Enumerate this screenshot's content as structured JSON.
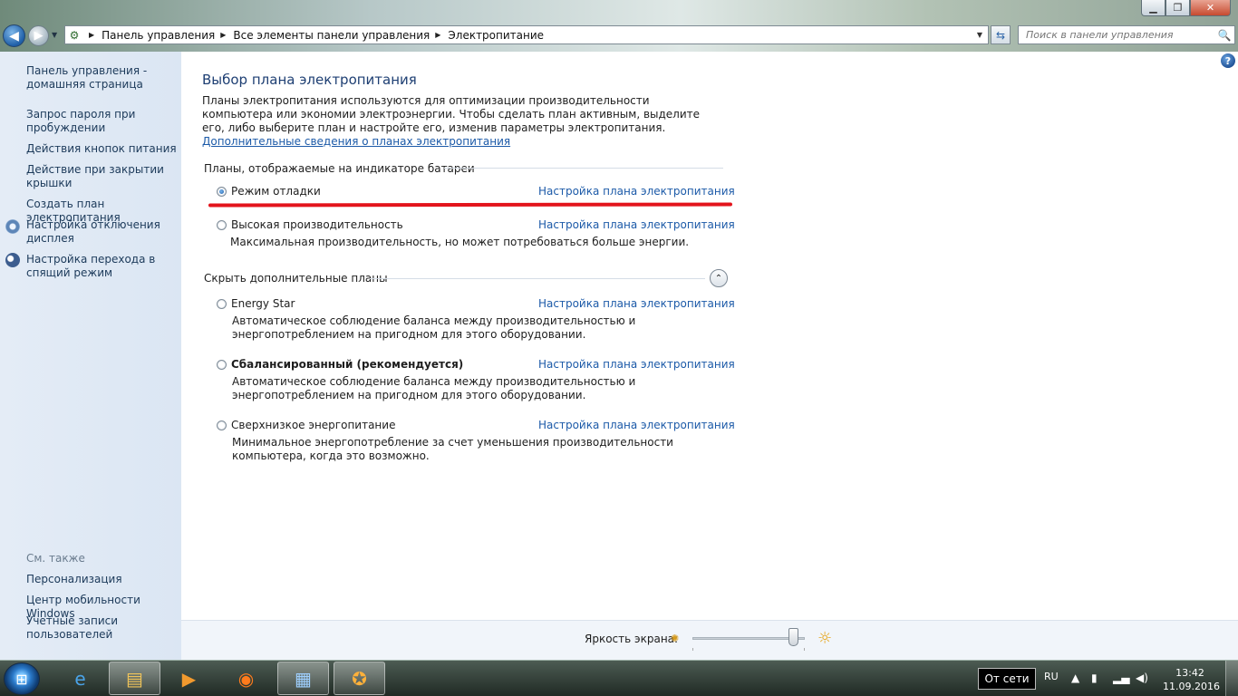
{
  "window": {
    "controls": {
      "minimize": "▁",
      "maximize": "❐",
      "close": "✕"
    }
  },
  "nav": {
    "breadcrumbs": [
      "Панель управления",
      "Все элементы панели управления",
      "Электропитание"
    ],
    "search_placeholder": "Поиск в панели управления"
  },
  "sidebar": {
    "items": [
      {
        "label": "Панель управления - домашняя страница"
      },
      {
        "label": "Запрос пароля при пробуждении"
      },
      {
        "label": "Действия кнопок питания"
      },
      {
        "label": "Действие при закрытии крышки"
      },
      {
        "label": "Создать план электропитания"
      },
      {
        "label": "Настройка отключения дисплея",
        "icon": "monitor-icon"
      },
      {
        "label": "Настройка перехода в спящий режим",
        "icon": "moon-icon"
      }
    ],
    "see_also_title": "См. также",
    "see_also": [
      {
        "label": "Персонализация"
      },
      {
        "label": "Центр мобильности Windows"
      },
      {
        "label": "Учетные записи пользователей"
      }
    ]
  },
  "main": {
    "title": "Выбор плана электропитания",
    "intro": "Планы электропитания используются для оптимизации производительности компьютера или экономии электроэнергии. Чтобы сделать план активным, выделите его, либо выберите план и настройте его, изменив параметры электропитания.",
    "intro_link": "Дополнительные сведения о планах электропитания",
    "battery_group_title": "Планы, отображаемые на индикаторе батареи",
    "hidden_group_title": "Скрыть дополнительные планы",
    "plan_link_label": "Настройка плана электропитания",
    "plans": [
      {
        "name": "Режим отладки",
        "desc": "",
        "checked": true,
        "bold": false
      },
      {
        "name": "Высокая производительность",
        "desc": "Максимальная производительность, но может потребоваться больше энергии.",
        "checked": false,
        "bold": false
      },
      {
        "name": "Energy Star",
        "desc": "Автоматическое соблюдение баланса между производительностью и энергопотреблением на пригодном для этого оборудовании.",
        "checked": false,
        "bold": false
      },
      {
        "name": "Сбалансированный (рекомендуется)",
        "desc": "Автоматическое соблюдение баланса между производительностью и энергопотреблением на пригодном для этого оборудовании.",
        "checked": false,
        "bold": true
      },
      {
        "name": "Сверхнизкое энергопитание",
        "desc": "Минимальное энергопотребление за счет уменьшения производительности компьютера, когда это возможно.",
        "checked": false,
        "bold": false
      }
    ],
    "brightness_label": "Яркость экрана:",
    "brightness_level": 0.9,
    "annotation_color": "#e3141c"
  },
  "taskbar": {
    "tooltip": "От сети",
    "language": "RU",
    "time": "13:42",
    "date": "11.09.2016",
    "apps": [
      "internet-explorer-icon",
      "explorer-folder-icon",
      "media-player-icon",
      "firefox-icon",
      "control-panel-icon",
      "game-icon"
    ]
  }
}
